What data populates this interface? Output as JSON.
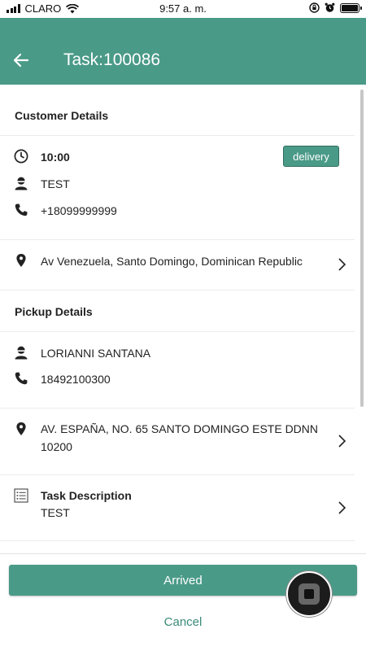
{
  "status_bar": {
    "carrier": "CLARO",
    "time": "9:57 a. m."
  },
  "header": {
    "title": "Task:100086"
  },
  "customer": {
    "section_title": "Customer Details",
    "time": "10:00",
    "badge": "delivery",
    "name": "TEST",
    "phone": "+18099999999",
    "address": "Av Venezuela, Santo Domingo, Dominican Republic"
  },
  "pickup": {
    "section_title": "Pickup Details",
    "name": "LORIANNI SANTANA",
    "phone": "18492100300",
    "address_line1": "AV. ESPAÑA, NO. 65 SANTO DOMINGO ESTE DDNN",
    "address_line2": "10200"
  },
  "task_description": {
    "label": "Task Description",
    "value": "TEST"
  },
  "actions": {
    "arrived": "Arrived",
    "cancel": "Cancel"
  },
  "colors": {
    "primary": "#4a9a88",
    "badge_border": "#2f6e60",
    "link": "#3a8a78"
  }
}
